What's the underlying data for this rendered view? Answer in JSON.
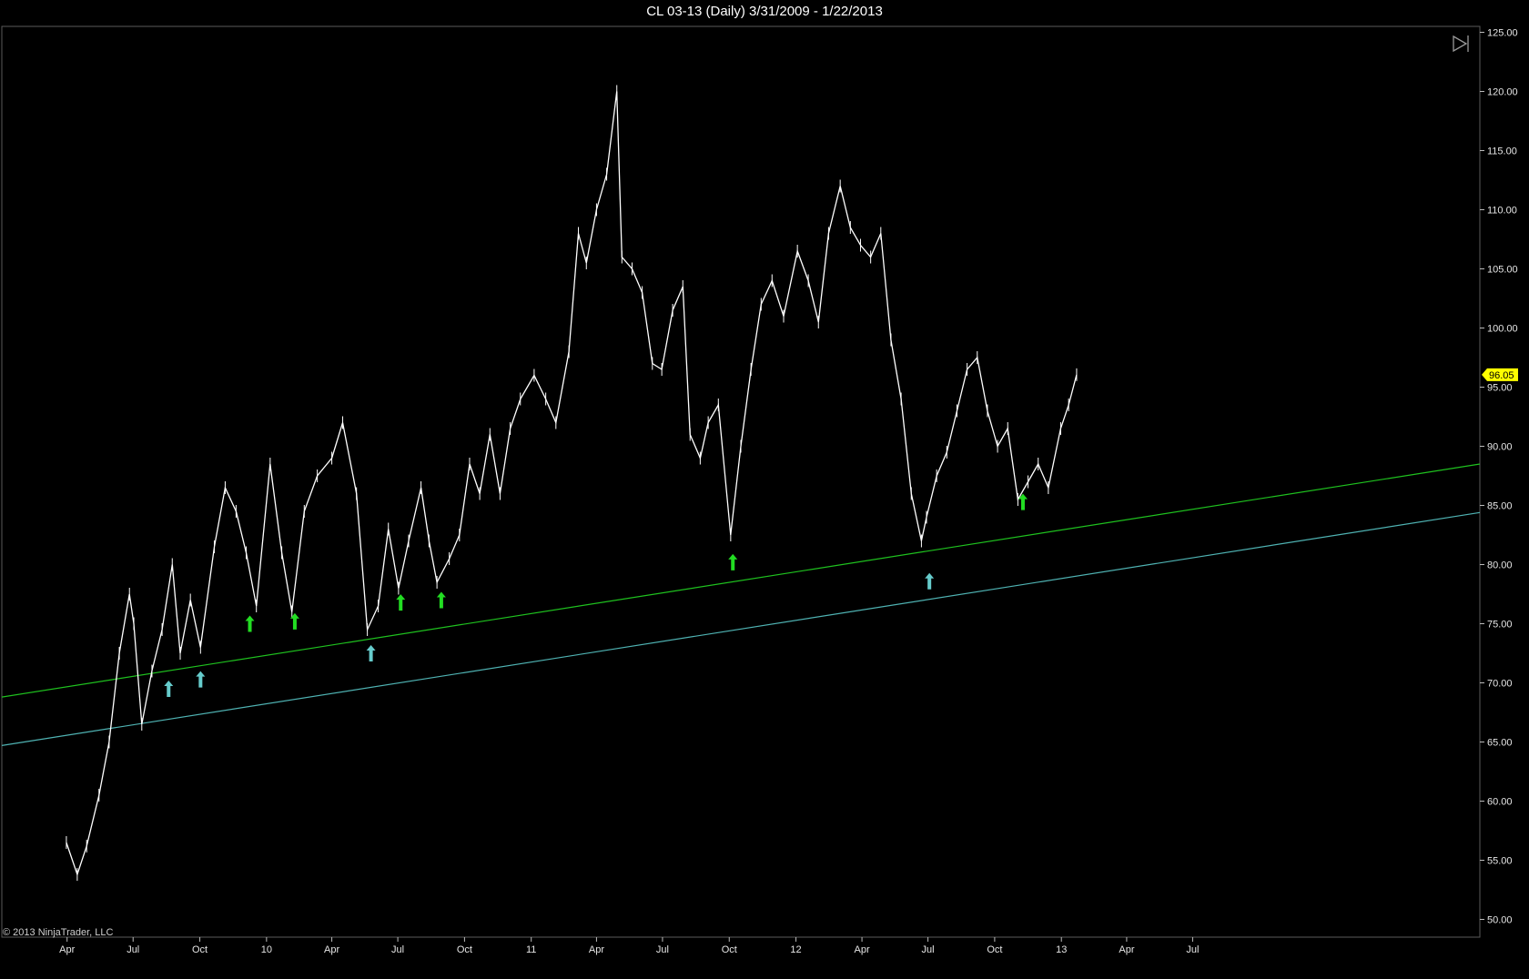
{
  "title": "CL 03-13 (Daily)  3/31/2009 - 1/22/2013",
  "copyright": "© 2013 NinjaTrader, LLC",
  "current_price_label": "96.05",
  "colors": {
    "background": "#000000",
    "price_bars": "#ffffff",
    "upper_trendline": "#1fc21f",
    "lower_trendline": "#4fb3b3",
    "green_arrow": "#22dd22",
    "cyan_arrow": "#66cccc",
    "price_tag": "#ffff00"
  },
  "chart_data": {
    "type": "line",
    "title": "CL 03-13 (Daily)  3/31/2009 - 1/22/2013",
    "xlabel": "",
    "ylabel": "",
    "ylim": [
      48.5,
      125.5
    ],
    "xlim": [
      "2009-01-01",
      "2014-08-01"
    ],
    "y_ticks": [
      "50.00",
      "55.00",
      "60.00",
      "65.00",
      "70.00",
      "75.00",
      "80.00",
      "85.00",
      "90.00",
      "95.00",
      "100.00",
      "105.00",
      "110.00",
      "115.00",
      "120.00",
      "125.00"
    ],
    "x_ticks": [
      {
        "date": "2009-04-01",
        "label": "Apr"
      },
      {
        "date": "2009-07-01",
        "label": "Jul"
      },
      {
        "date": "2009-10-01",
        "label": "Oct"
      },
      {
        "date": "2010-01-01",
        "label": "10"
      },
      {
        "date": "2010-04-01",
        "label": "Apr"
      },
      {
        "date": "2010-07-01",
        "label": "Jul"
      },
      {
        "date": "2010-10-01",
        "label": "Oct"
      },
      {
        "date": "2011-01-01",
        "label": "11"
      },
      {
        "date": "2011-04-01",
        "label": "Apr"
      },
      {
        "date": "2011-07-01",
        "label": "Jul"
      },
      {
        "date": "2011-10-01",
        "label": "Oct"
      },
      {
        "date": "2012-01-01",
        "label": "12"
      },
      {
        "date": "2012-04-01",
        "label": "Apr"
      },
      {
        "date": "2012-07-01",
        "label": "Jul"
      },
      {
        "date": "2012-10-01",
        "label": "Oct"
      },
      {
        "date": "2013-01-01",
        "label": "13"
      },
      {
        "date": "2013-04-01",
        "label": "Apr"
      },
      {
        "date": "2013-07-01",
        "label": "Jul"
      }
    ],
    "grid": false,
    "series": [
      {
        "style": "price-bars",
        "points": [
          [
            "2009-03-31",
            56.5
          ],
          [
            "2009-04-15",
            53.8
          ],
          [
            "2009-04-28",
            56.2
          ],
          [
            "2009-05-15",
            60.5
          ],
          [
            "2009-05-29",
            65.0
          ],
          [
            "2009-06-12",
            72.5
          ],
          [
            "2009-06-26",
            77.5
          ],
          [
            "2009-07-02",
            75.0
          ],
          [
            "2009-07-13",
            66.5
          ],
          [
            "2009-07-27",
            71.0
          ],
          [
            "2009-08-10",
            74.5
          ],
          [
            "2009-08-24",
            80.0
          ],
          [
            "2009-09-04",
            72.5
          ],
          [
            "2009-09-18",
            77.0
          ],
          [
            "2009-10-02",
            73.0
          ],
          [
            "2009-10-21",
            81.5
          ],
          [
            "2009-11-05",
            86.5
          ],
          [
            "2009-11-20",
            84.5
          ],
          [
            "2009-12-04",
            81.0
          ],
          [
            "2009-12-18",
            76.5
          ],
          [
            "2010-01-06",
            88.5
          ],
          [
            "2010-01-22",
            81.0
          ],
          [
            "2010-02-05",
            76.0
          ],
          [
            "2010-02-22",
            84.5
          ],
          [
            "2010-03-12",
            87.5
          ],
          [
            "2010-04-01",
            89.0
          ],
          [
            "2010-04-16",
            92.0
          ],
          [
            "2010-05-05",
            86.0
          ],
          [
            "2010-05-20",
            74.5
          ],
          [
            "2010-06-04",
            76.5
          ],
          [
            "2010-06-18",
            83.0
          ],
          [
            "2010-07-02",
            78.0
          ],
          [
            "2010-07-16",
            82.0
          ],
          [
            "2010-08-02",
            86.5
          ],
          [
            "2010-08-13",
            82.0
          ],
          [
            "2010-08-24",
            78.5
          ],
          [
            "2010-09-10",
            80.5
          ],
          [
            "2010-09-24",
            82.5
          ],
          [
            "2010-10-08",
            88.5
          ],
          [
            "2010-10-22",
            86.0
          ],
          [
            "2010-11-05",
            91.0
          ],
          [
            "2010-11-19",
            86.0
          ],
          [
            "2010-12-03",
            91.5
          ],
          [
            "2010-12-17",
            94.0
          ],
          [
            "2011-01-05",
            96.0
          ],
          [
            "2011-01-21",
            94.0
          ],
          [
            "2011-02-04",
            92.0
          ],
          [
            "2011-02-22",
            98.0
          ],
          [
            "2011-03-07",
            108.0
          ],
          [
            "2011-03-18",
            105.5
          ],
          [
            "2011-04-01",
            110.0
          ],
          [
            "2011-04-15",
            113.0
          ],
          [
            "2011-04-29",
            120.0
          ],
          [
            "2011-05-06",
            106.0
          ],
          [
            "2011-05-20",
            105.0
          ],
          [
            "2011-06-03",
            103.0
          ],
          [
            "2011-06-17",
            97.0
          ],
          [
            "2011-06-30",
            96.5
          ],
          [
            "2011-07-15",
            101.5
          ],
          [
            "2011-07-29",
            103.5
          ],
          [
            "2011-08-08",
            91.0
          ],
          [
            "2011-08-22",
            89.0
          ],
          [
            "2011-09-02",
            92.0
          ],
          [
            "2011-09-16",
            93.5
          ],
          [
            "2011-10-03",
            82.5
          ],
          [
            "2011-10-17",
            90.0
          ],
          [
            "2011-10-31",
            96.5
          ],
          [
            "2011-11-14",
            102.0
          ],
          [
            "2011-11-29",
            104.0
          ],
          [
            "2011-12-15",
            101.0
          ],
          [
            "2012-01-03",
            106.5
          ],
          [
            "2012-01-18",
            104.0
          ],
          [
            "2012-02-01",
            100.5
          ],
          [
            "2012-02-15",
            108.0
          ],
          [
            "2012-03-02",
            112.0
          ],
          [
            "2012-03-16",
            108.5
          ],
          [
            "2012-03-30",
            107.0
          ],
          [
            "2012-04-13",
            106.0
          ],
          [
            "2012-04-27",
            108.0
          ],
          [
            "2012-05-11",
            99.0
          ],
          [
            "2012-05-25",
            94.0
          ],
          [
            "2012-06-08",
            86.0
          ],
          [
            "2012-06-22",
            82.0
          ],
          [
            "2012-06-29",
            84.0
          ],
          [
            "2012-07-13",
            87.5
          ],
          [
            "2012-07-27",
            89.5
          ],
          [
            "2012-08-10",
            93.0
          ],
          [
            "2012-08-24",
            96.5
          ],
          [
            "2012-09-07",
            97.5
          ],
          [
            "2012-09-21",
            93.0
          ],
          [
            "2012-10-05",
            90.0
          ],
          [
            "2012-10-19",
            91.5
          ],
          [
            "2012-11-02",
            85.5
          ],
          [
            "2012-11-16",
            87.0
          ],
          [
            "2012-11-30",
            88.5
          ],
          [
            "2012-12-14",
            86.5
          ],
          [
            "2012-12-31",
            91.5
          ],
          [
            "2013-01-11",
            93.5
          ],
          [
            "2013-01-22",
            96.05
          ]
        ]
      },
      {
        "style": "trendline",
        "color": "#1fc21f",
        "points": [
          [
            "2009-01-01",
            68.8
          ],
          [
            "2014-08-01",
            88.5
          ]
        ]
      },
      {
        "style": "trendline",
        "color": "#4fb3b3",
        "points": [
          [
            "2009-01-01",
            64.7
          ],
          [
            "2014-08-01",
            84.4
          ]
        ]
      },
      {
        "style": "up-arrows",
        "color": "#22dd22",
        "points": [
          [
            "2009-12-09",
            75.0
          ],
          [
            "2010-02-09",
            75.2
          ],
          [
            "2010-07-05",
            76.8
          ],
          [
            "2010-08-30",
            77.0
          ],
          [
            "2011-10-06",
            80.2
          ],
          [
            "2012-11-09",
            85.3
          ]
        ]
      },
      {
        "style": "up-arrows",
        "color": "#66cccc",
        "points": [
          [
            "2009-08-19",
            69.5
          ],
          [
            "2009-10-02",
            70.3
          ],
          [
            "2010-05-25",
            72.5
          ],
          [
            "2012-07-03",
            78.6
          ]
        ]
      }
    ]
  }
}
